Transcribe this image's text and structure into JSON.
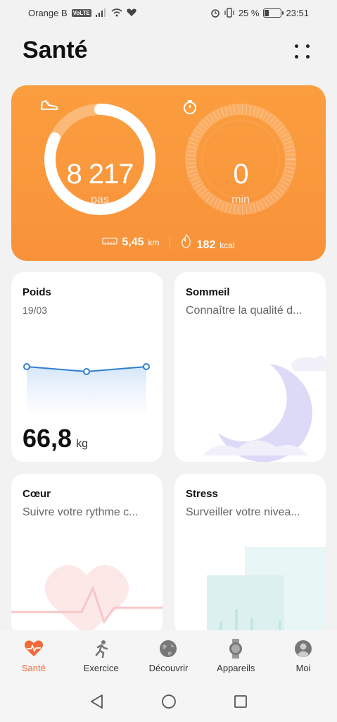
{
  "status_bar": {
    "carrier": "Orange B",
    "volte": "VoLTE",
    "battery": "25 %",
    "time": "23:51"
  },
  "header": {
    "title": "Santé"
  },
  "activity": {
    "steps_value": "8 217",
    "steps_unit": "pas",
    "steps_progress": 0.82,
    "time_value": "0",
    "time_unit": "min",
    "time_progress": 0,
    "distance_value": "5,45",
    "distance_unit": "km",
    "calories_value": "182",
    "calories_unit": "kcal"
  },
  "cards": {
    "poids": {
      "title": "Poids",
      "date": "19/03",
      "value": "66,8",
      "unit": "kg"
    },
    "sommeil": {
      "title": "Sommeil",
      "subtitle": "Connaître la qualité d..."
    },
    "coeur": {
      "title": "Cœur",
      "subtitle": "Suivre votre rythme c..."
    },
    "stress": {
      "title": "Stress",
      "subtitle": "Surveiller votre nivea..."
    }
  },
  "nav": {
    "items": [
      {
        "label": "Santé",
        "icon": "heart-icon",
        "active": true
      },
      {
        "label": "Exercice",
        "icon": "runner-icon",
        "active": false
      },
      {
        "label": "Découvrir",
        "icon": "globe-icon",
        "active": false
      },
      {
        "label": "Appareils",
        "icon": "watch-icon",
        "active": false
      },
      {
        "label": "Moi",
        "icon": "profile-icon",
        "active": false
      }
    ]
  },
  "colors": {
    "accent": "#f06a3a",
    "activity_card": "#f8923a",
    "chart_line": "#2f80d0"
  }
}
